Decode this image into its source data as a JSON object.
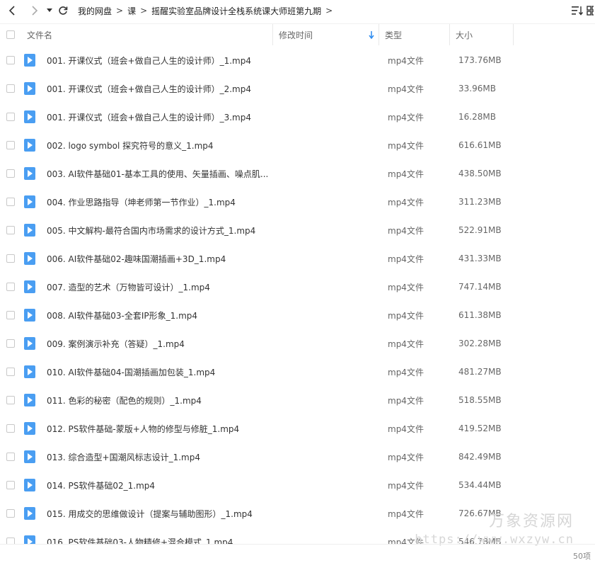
{
  "nav": {
    "back_icon": "chevron-left-icon",
    "forward_icon": "chevron-right-icon",
    "dropdown_icon": "caret-down-icon",
    "refresh_icon": "refresh-icon"
  },
  "breadcrumb": [
    "我的网盘",
    "课",
    "摇醒实验室品牌设计全栈系统课大师班第九期"
  ],
  "header": {
    "name": "文件名",
    "modified": "修改时间",
    "type": "类型",
    "size": "大小"
  },
  "files": [
    {
      "name": "001. 开课仪式（班会+做自己人生的设计师）_1.mp4",
      "type": "mp4文件",
      "size": "173.76MB"
    },
    {
      "name": "001. 开课仪式（班会+做自己人生的设计师）_2.mp4",
      "type": "mp4文件",
      "size": "33.96MB"
    },
    {
      "name": "001. 开课仪式（班会+做自己人生的设计师）_3.mp4",
      "type": "mp4文件",
      "size": "16.28MB"
    },
    {
      "name": "002. logo symbol 探究符号的意义_1.mp4",
      "type": "mp4文件",
      "size": "616.61MB"
    },
    {
      "name": "003. AI软件基础01-基本工具的使用、矢量插画、噪点肌...",
      "type": "mp4文件",
      "size": "438.50MB"
    },
    {
      "name": "004. 作业思路指导（坤老师第一节作业）_1.mp4",
      "type": "mp4文件",
      "size": "311.23MB"
    },
    {
      "name": "005. 中文解构-最符合国内市场需求的设计方式_1.mp4",
      "type": "mp4文件",
      "size": "522.91MB"
    },
    {
      "name": "006. AI软件基础02-趣味国潮插画+3D_1.mp4",
      "type": "mp4文件",
      "size": "431.33MB"
    },
    {
      "name": "007. 造型的艺术（万物皆可设计）_1.mp4",
      "type": "mp4文件",
      "size": "747.14MB"
    },
    {
      "name": "008. AI软件基础03-全套IP形象_1.mp4",
      "type": "mp4文件",
      "size": "611.38MB"
    },
    {
      "name": "009. 案例演示补充（答疑）_1.mp4",
      "type": "mp4文件",
      "size": "302.28MB"
    },
    {
      "name": "010. AI软件基础04-国潮插画加包装_1.mp4",
      "type": "mp4文件",
      "size": "481.27MB"
    },
    {
      "name": "011. 色彩的秘密（配色的规则）_1.mp4",
      "type": "mp4文件",
      "size": "518.55MB"
    },
    {
      "name": "012. PS软件基础-蒙版+人物的修型与修脏_1.mp4",
      "type": "mp4文件",
      "size": "419.52MB"
    },
    {
      "name": "013. 综合造型+国潮风标志设计_1.mp4",
      "type": "mp4文件",
      "size": "842.49MB"
    },
    {
      "name": "014. PS软件基础02_1.mp4",
      "type": "mp4文件",
      "size": "534.44MB"
    },
    {
      "name": "015. 用成交的思维做设计（提案与辅助图形）_1.mp4",
      "type": "mp4文件",
      "size": "726.67MB"
    },
    {
      "name": "016. PS软件基础03-人物精修+混合模式_1.mp4",
      "type": "mp4文件",
      "size": "546.78MB"
    }
  ],
  "watermark": {
    "cn": "万象资源网",
    "url": "https://www.wxzyw.cn"
  },
  "footer": {
    "count": "50项"
  },
  "colors": {
    "file_icon": "#4a9ef2",
    "sort_arrow": "#2f8cf0"
  }
}
